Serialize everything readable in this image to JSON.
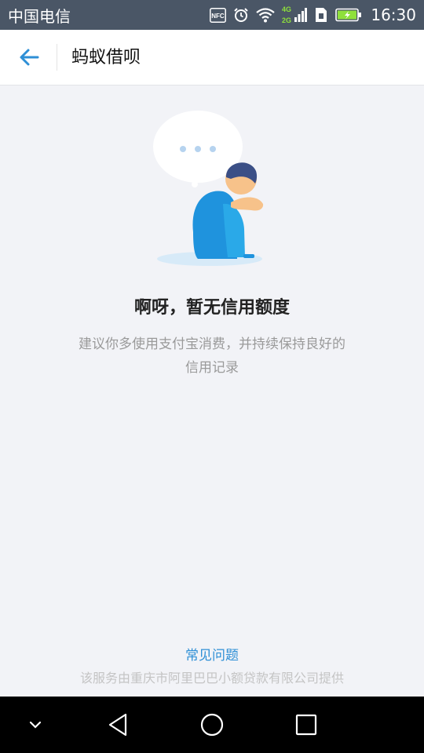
{
  "status_bar": {
    "carrier": "中国电信",
    "nfc": "NFC",
    "network": [
      "4G",
      "2G"
    ],
    "time": "16:30",
    "icons": [
      "nfc-icon",
      "alarm-icon",
      "wifi-icon",
      "signal-icon",
      "sim-icon",
      "battery-charging-icon"
    ]
  },
  "header": {
    "back_icon": "arrow-left-icon",
    "title": "蚂蚁借呗"
  },
  "empty_state": {
    "illustration": "person-hugging-knees-with-thought-bubble",
    "title": "啊呀，暂无信用额度",
    "description": "建议你多使用支付宝消费，并持续保持良好的信用记录"
  },
  "footer": {
    "faq_link": "常见问题",
    "provider": "该服务由重庆市阿里巴巴小额贷款有限公司提供"
  },
  "nav_bar": {
    "icons": [
      "chevron-down-icon",
      "back-triangle-icon",
      "home-circle-icon",
      "recents-square-icon"
    ]
  },
  "colors": {
    "status_bar": "#4a5666",
    "accent": "#2e8fd6",
    "background": "#f2f3f7",
    "figure_blue": "#1f93dd",
    "figure_light_blue": "#2aa9e8"
  }
}
